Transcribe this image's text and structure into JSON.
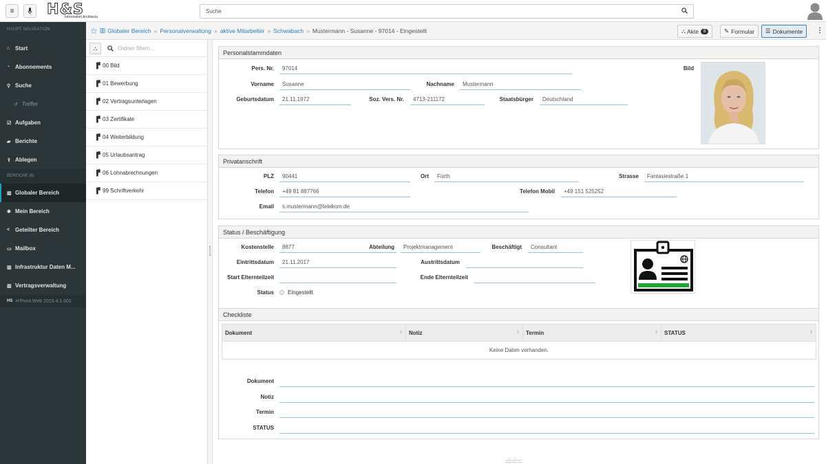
{
  "topbar": {
    "logo_text": "H&S",
    "logo_sub": "Information Architects",
    "search_placeholder": "Suche"
  },
  "sidebar": {
    "header": "HAUPT NAVIGATION",
    "items": [
      {
        "label": "Start",
        "icon": "home-icon"
      },
      {
        "label": "Abonnements",
        "icon": "rss-icon"
      },
      {
        "label": "Suche",
        "icon": "search-icon"
      },
      {
        "label": "Treffer",
        "icon": "history-icon"
      },
      {
        "label": "Aufgaben",
        "icon": "check-icon"
      },
      {
        "label": "Berichte",
        "icon": "book-icon"
      },
      {
        "label": "Ablegen",
        "icon": "upload-icon"
      }
    ],
    "section_label": "BEREICHE (6)",
    "areas": [
      {
        "label": "Globaler Bereich",
        "icon": "building-icon"
      },
      {
        "label": "Mein Bereich",
        "icon": "person-icon"
      },
      {
        "label": "Geteilter Bereich",
        "icon": "share-icon"
      },
      {
        "label": "Mailbox",
        "icon": "inbox-icon"
      },
      {
        "label": "Infrastruktur Daten M...",
        "icon": "building-icon"
      },
      {
        "label": "Vertragsverwaltung",
        "icon": "building-icon"
      }
    ],
    "footer_logo": "HS",
    "footer_version": "H’Point.Web 2019.4.1.001"
  },
  "breadcrumb": {
    "items": [
      "Globaler Bereich",
      "Personalverwaltung",
      "aktive Mitarbeiter",
      "Schwabach"
    ],
    "current": "Mustermann - Susanne - 97014 - Eingestellt",
    "separator": "»"
  },
  "tabs": {
    "akte": "Akte",
    "akte_count": "8",
    "formular": "Formular",
    "dokumente": "Dokumente"
  },
  "folders": {
    "filter_placeholder": "Ordner filtern...",
    "items": [
      "00 Bild",
      "01 Bewerbung",
      "02 Vertragsunterlagen",
      "03 Zertifikate",
      "04 Weiterbildung",
      "05 Urlaubsantrag",
      "06 Lohnabrechnungen",
      "99 Schriftverkehr"
    ]
  },
  "stamm": {
    "title": "Personalstammdaten",
    "persnr_label": "Pers. Nr.",
    "persnr": "97014",
    "bild_label": "Bild",
    "vorname_label": "Vorname",
    "vorname": "Susanne",
    "nachname_label": "Nachname",
    "nachname": "Mustermann",
    "geb_label": "Geburtsdatum",
    "geb": "21.11.1972",
    "sozvers_label": "Soz. Vers. Nr.",
    "sozvers": "4713-211172",
    "staats_label": "Staatsbürger",
    "staats": "Deutschland"
  },
  "privat": {
    "title": "Privatanschrift",
    "plz_label": "PLZ",
    "plz": "90441",
    "ort_label": "Ort",
    "ort": "Fürth",
    "strasse_label": "Strasse",
    "strasse": "Fantasiestraße 1",
    "telefon_label": "Telefon",
    "telefon": "+49 81 887766",
    "mobil_label": "Telefon Mobil",
    "mobil": "+49 151 525252",
    "email_label": "Email",
    "email": "s.mustermann@telekom.de"
  },
  "status": {
    "title": "Status / Beschäftigung",
    "kst_label": "Kostenstelle",
    "kst": "8877",
    "abt_label": "Abteilung",
    "abt": "Projektmanagement",
    "besch_label": "Beschäftigt",
    "besch": "Consultant",
    "eintritt_label": "Eintrittsdatum",
    "eintritt": "21.11.2017",
    "austritt_label": "Austrittsdatum",
    "austritt": "",
    "start_label": "Start Elternteilzeit",
    "start": "",
    "ende_label": "Ende Elternteilzeit",
    "ende": "",
    "status_label": "Status",
    "status": "Eingestellt"
  },
  "checklist": {
    "title": "Checkliste",
    "columns": [
      "Dokument",
      "Notiz",
      "Termin",
      "STATUS"
    ],
    "empty": "Keine Daten vorhanden.",
    "form": [
      "Dokument",
      "Notiz",
      "Termin",
      "STATUS"
    ]
  },
  "colors": {
    "sidebar": "#2c3538",
    "accent": "#1da2c4",
    "link": "#2f7fb8",
    "badge_bar": "#21a336"
  }
}
